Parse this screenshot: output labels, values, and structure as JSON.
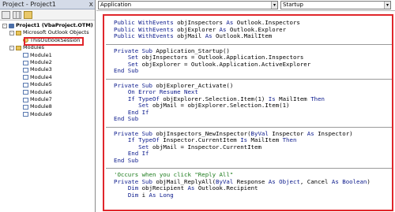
{
  "project": {
    "title": "Project - Project1",
    "close_glyph": "x",
    "tree": [
      {
        "label": "Project1 (VbaProject.OTM)",
        "icon": "project-icon",
        "expander": "-"
      },
      {
        "label": "Microsoft Outlook Objects",
        "icon": "folder-icon",
        "expander": "-"
      },
      {
        "label": "ThisOutlookSession",
        "icon": "session-icon",
        "expander": ""
      },
      {
        "label": "Modules",
        "icon": "folder-icon",
        "expander": "-"
      },
      {
        "label": "Module1",
        "icon": "module-icon",
        "expander": ""
      },
      {
        "label": "Module2",
        "icon": "module-icon",
        "expander": ""
      },
      {
        "label": "Module3",
        "icon": "module-icon",
        "expander": ""
      },
      {
        "label": "Module4",
        "icon": "module-icon",
        "expander": ""
      },
      {
        "label": "Module5",
        "icon": "module-icon",
        "expander": ""
      },
      {
        "label": "Module6",
        "icon": "module-icon",
        "expander": ""
      },
      {
        "label": "Module7",
        "icon": "module-icon",
        "expander": ""
      },
      {
        "label": "Module8",
        "icon": "module-icon",
        "expander": ""
      },
      {
        "label": "Module9",
        "icon": "module-icon",
        "expander": ""
      }
    ]
  },
  "code_header": {
    "object_combo": "Application",
    "procedure_combo": "Startup",
    "arrow_glyph": "▾"
  },
  "code_blocks": [
    [
      [
        [
          "kw",
          "Public WithEvents"
        ],
        [
          "t",
          " objInspectors "
        ],
        [
          "kw",
          "As"
        ],
        [
          "t",
          " Outlook.Inspectors"
        ]
      ],
      [
        [
          "kw",
          "Public WithEvents"
        ],
        [
          "t",
          " objExplorer "
        ],
        [
          "kw",
          "As"
        ],
        [
          "t",
          " Outlook.Explorer"
        ]
      ],
      [
        [
          "kw",
          "Public WithEvents"
        ],
        [
          "t",
          " objMail "
        ],
        [
          "kw",
          "As"
        ],
        [
          "t",
          " Outlook.MailItem"
        ]
      ]
    ],
    [
      [
        [
          "kw",
          "Private Sub"
        ],
        [
          "t",
          " Application_Startup()"
        ]
      ],
      [
        [
          "t",
          "    "
        ],
        [
          "kw",
          "Set"
        ],
        [
          "t",
          " objInspectors = Outlook.Application.Inspectors"
        ]
      ],
      [
        [
          "t",
          "    "
        ],
        [
          "kw",
          "Set"
        ],
        [
          "t",
          " objExplorer = Outlook.Application.ActiveExplorer"
        ]
      ],
      [
        [
          "kw",
          "End Sub"
        ]
      ]
    ],
    [
      [
        [
          "kw",
          "Private Sub"
        ],
        [
          "t",
          " objExplorer_Activate()"
        ]
      ],
      [
        [
          "t",
          "    "
        ],
        [
          "kw",
          "On Error Resume Next"
        ]
      ],
      [
        [
          "t",
          "    "
        ],
        [
          "kw",
          "If TypeOf"
        ],
        [
          "t",
          " objExplorer.Selection.Item(1) "
        ],
        [
          "kw",
          "Is"
        ],
        [
          "t",
          " MailItem "
        ],
        [
          "kw",
          "Then"
        ]
      ],
      [
        [
          "t",
          "       "
        ],
        [
          "kw",
          "Set"
        ],
        [
          "t",
          " objMail = objExplorer.Selection.Item(1)"
        ]
      ],
      [
        [
          "t",
          "    "
        ],
        [
          "kw",
          "End If"
        ]
      ],
      [
        [
          "kw",
          "End Sub"
        ]
      ]
    ],
    [
      [
        [
          "kw",
          "Private Sub"
        ],
        [
          "t",
          " objInspectors_NewInspector("
        ],
        [
          "kw",
          "ByVal"
        ],
        [
          "t",
          " Inspector "
        ],
        [
          "kw",
          "As"
        ],
        [
          "t",
          " Inspector)"
        ]
      ],
      [
        [
          "t",
          "    "
        ],
        [
          "kw",
          "If TypeOf"
        ],
        [
          "t",
          " Inspector.CurrentItem "
        ],
        [
          "kw",
          "Is"
        ],
        [
          "t",
          " MailItem "
        ],
        [
          "kw",
          "Then"
        ]
      ],
      [
        [
          "t",
          "       "
        ],
        [
          "kw",
          "Set"
        ],
        [
          "t",
          " objMail = Inspector.CurrentItem"
        ]
      ],
      [
        [
          "t",
          "    "
        ],
        [
          "kw",
          "End If"
        ]
      ],
      [
        [
          "kw",
          "End Sub"
        ]
      ]
    ],
    [
      [
        [
          "cm",
          "'Occurs when you click \"Reply All\""
        ]
      ],
      [
        [
          "kw",
          "Private Sub"
        ],
        [
          "t",
          " objMail_ReplyAll("
        ],
        [
          "kw",
          "ByVal"
        ],
        [
          "t",
          " Response "
        ],
        [
          "kw",
          "As Object"
        ],
        [
          "t",
          ", Cancel "
        ],
        [
          "kw",
          "As Boolean"
        ],
        [
          "t",
          ")"
        ]
      ],
      [
        [
          "t",
          "    "
        ],
        [
          "kw",
          "Dim"
        ],
        [
          "t",
          " objRecipient "
        ],
        [
          "kw",
          "As"
        ],
        [
          "t",
          " Outlook.Recipient"
        ]
      ],
      [
        [
          "t",
          "    "
        ],
        [
          "kw",
          "Dim"
        ],
        [
          "t",
          " i "
        ],
        [
          "kw",
          "As Long"
        ]
      ]
    ]
  ],
  "colors": {
    "keyword": "#0b1a8c",
    "comment": "#1a7a1a",
    "highlight_border": "#e0262b"
  }
}
